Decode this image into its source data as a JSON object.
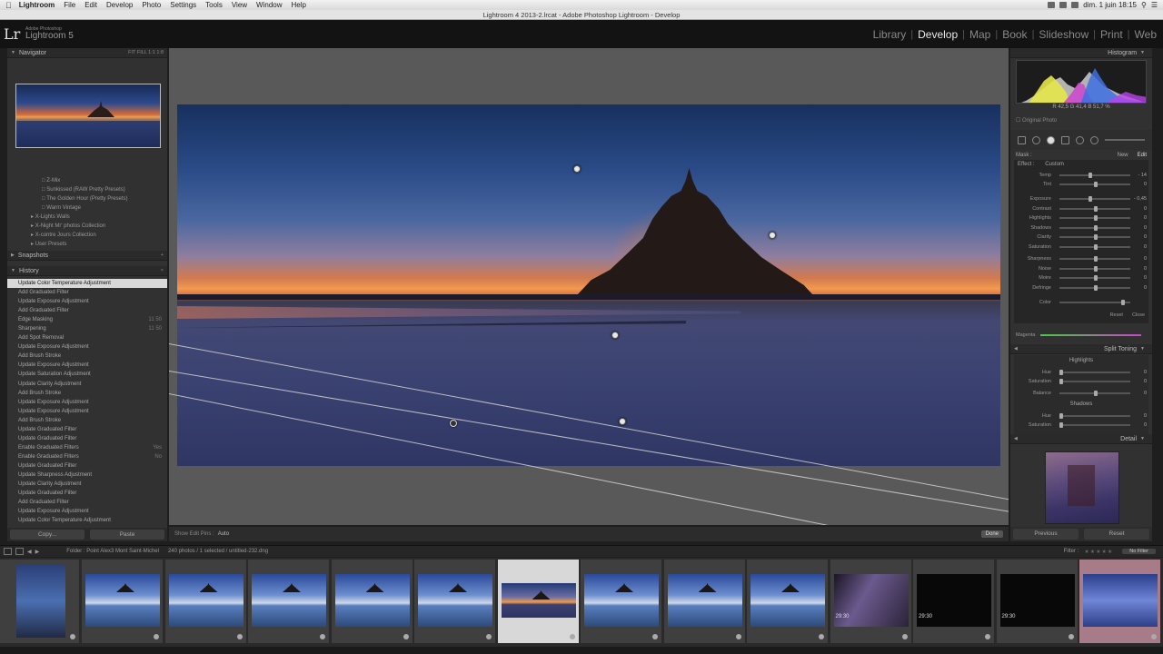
{
  "menubar": {
    "app": "Lightroom",
    "items": [
      "File",
      "Edit",
      "Develop",
      "Photo",
      "Settings",
      "Tools",
      "View",
      "Window",
      "Help"
    ],
    "clock": "dim. 1 juin  18:15"
  },
  "window_title": "Lightroom 4 2013-2.lrcat - Adobe Photoshop Lightroom - Develop",
  "identity": {
    "lr": "Lr",
    "line1": "Adobe Photoshop",
    "line2": "Lightroom 5"
  },
  "modules": [
    {
      "label": "Library"
    },
    {
      "label": "Develop",
      "active": true
    },
    {
      "label": "Map"
    },
    {
      "label": "Book"
    },
    {
      "label": "Slideshow"
    },
    {
      "label": "Print"
    },
    {
      "label": "Web"
    }
  ],
  "left": {
    "navigator_title": "Navigator",
    "navigator_zoom": "FIT  FILL  1:1  1:8",
    "presets": [
      "Z-Mix",
      "Sunkissed (RAW Pretty Presets)",
      "The Golden Hour (Pretty Presets)",
      "Warm Vintage",
      "X-Lights Walls",
      "X-Night Mr' photos Collection",
      "X-contre Jours Collection",
      "User Presets"
    ],
    "snapshots_title": "Snapshots",
    "history_title": "History",
    "history": [
      {
        "label": "Update Color Temperature Adjustment",
        "value": ""
      },
      {
        "label": "Add Graduated Filter",
        "value": ""
      },
      {
        "label": "Update Exposure Adjustment",
        "value": ""
      },
      {
        "label": "Add Graduated Filter",
        "value": ""
      },
      {
        "label": "Edge Masking",
        "value": "11    50"
      },
      {
        "label": "Sharpening",
        "value": "11    50"
      },
      {
        "label": "Add Spot Removal",
        "value": ""
      },
      {
        "label": "Update Exposure Adjustment",
        "value": ""
      },
      {
        "label": "Add Brush Stroke",
        "value": ""
      },
      {
        "label": "Update Exposure Adjustment",
        "value": ""
      },
      {
        "label": "Update Saturation Adjustment",
        "value": ""
      },
      {
        "label": "Update Clarity Adjustment",
        "value": ""
      },
      {
        "label": "Add Brush Stroke",
        "value": ""
      },
      {
        "label": "Update Exposure Adjustment",
        "value": ""
      },
      {
        "label": "Update Exposure Adjustment",
        "value": ""
      },
      {
        "label": "Add Brush Stroke",
        "value": ""
      },
      {
        "label": "Update Graduated Filter",
        "value": ""
      },
      {
        "label": "Update Graduated Filter",
        "value": ""
      },
      {
        "label": "Enable Graduated Filters",
        "value": "Yes"
      },
      {
        "label": "Enable Graduated Filters",
        "value": "No"
      },
      {
        "label": "Update Graduated Filter",
        "value": ""
      },
      {
        "label": "Update Sharpness Adjustment",
        "value": ""
      },
      {
        "label": "Update Clarity Adjustment",
        "value": ""
      },
      {
        "label": "Update Graduated Filter",
        "value": ""
      },
      {
        "label": "Add Graduated Filter",
        "value": ""
      },
      {
        "label": "Update Exposure Adjustment",
        "value": ""
      },
      {
        "label": "Update Color Temperature Adjustment",
        "value": ""
      }
    ],
    "copy": "Copy...",
    "paste": "Paste"
  },
  "toolbar": {
    "show_edit_pins_label": "Show Edit Pins :",
    "show_edit_pins_value": "Auto",
    "done": "Done"
  },
  "right": {
    "histogram_title": "Histogram",
    "histogram_values": "R  42,5   G  41,4   B  51,7 %",
    "original_photo": "Original Photo",
    "mask_label": "Mask :",
    "mask_new": "New",
    "mask_edit": "Edit",
    "effect_label": "Effect :",
    "effect_value": "Custom",
    "sliders_a": [
      {
        "label": "Temp",
        "value": "- 14",
        "pos": 0.42
      },
      {
        "label": "Tint",
        "value": "0",
        "pos": 0.5
      },
      {
        "label": "Exposure",
        "value": "- 0,45",
        "pos": 0.42
      },
      {
        "label": "Contrast",
        "value": "0",
        "pos": 0.5
      },
      {
        "label": "Highlights",
        "value": "0",
        "pos": 0.5
      },
      {
        "label": "Shadows",
        "value": "0",
        "pos": 0.5
      },
      {
        "label": "Clarity",
        "value": "0",
        "pos": 0.5
      },
      {
        "label": "Saturation",
        "value": "0",
        "pos": 0.5
      },
      {
        "label": "Sharpness",
        "value": "0",
        "pos": 0.5
      },
      {
        "label": "Noise",
        "value": "0",
        "pos": 0.5
      },
      {
        "label": "Moire",
        "value": "0",
        "pos": 0.5
      },
      {
        "label": "Defringe",
        "value": "0",
        "pos": 0.5
      },
      {
        "label": "Color",
        "value": "",
        "pos": 0.9
      }
    ],
    "reset": "Reset",
    "close": "Close",
    "magenta": "Magenta",
    "split_toning_title": "Split Toning",
    "highlights": "Highlights",
    "shadows": "Shadows",
    "split_sliders_hl": [
      {
        "label": "Hue",
        "value": "0",
        "pos": 0.0
      },
      {
        "label": "Saturation",
        "value": "0",
        "pos": 0.0
      }
    ],
    "balance": {
      "label": "Balance",
      "value": "0",
      "pos": 0.5
    },
    "split_sliders_sh": [
      {
        "label": "Hue",
        "value": "0",
        "pos": 0.0
      },
      {
        "label": "Saturation",
        "value": "0",
        "pos": 0.0
      }
    ],
    "detail_title": "Detail",
    "previous": "Previous",
    "reset_button": "Reset"
  },
  "filmbar": {
    "source": "Folder : Point Alex3 Mont Saint-Michel",
    "count": "240 photos / 1 selected / untitled-232.dng",
    "filter_label": "Filter :",
    "filter_value": "No Filter"
  },
  "filmstrip": [
    {
      "kind": "tall"
    },
    {
      "kind": "day"
    },
    {
      "kind": "day"
    },
    {
      "kind": "day"
    },
    {
      "kind": "day"
    },
    {
      "kind": "day"
    },
    {
      "kind": "dusk",
      "selected": true
    },
    {
      "kind": "day"
    },
    {
      "kind": "day"
    },
    {
      "kind": "day"
    },
    {
      "kind": "dark",
      "time": "29:30"
    },
    {
      "kind": "black",
      "time": "29:30"
    },
    {
      "kind": "black",
      "time": "29:30"
    },
    {
      "kind": "moon",
      "pink": true
    }
  ],
  "colors": {
    "accent": "#e8e8e8",
    "panel": "#313131",
    "selected_row": "#d8d8d8"
  }
}
